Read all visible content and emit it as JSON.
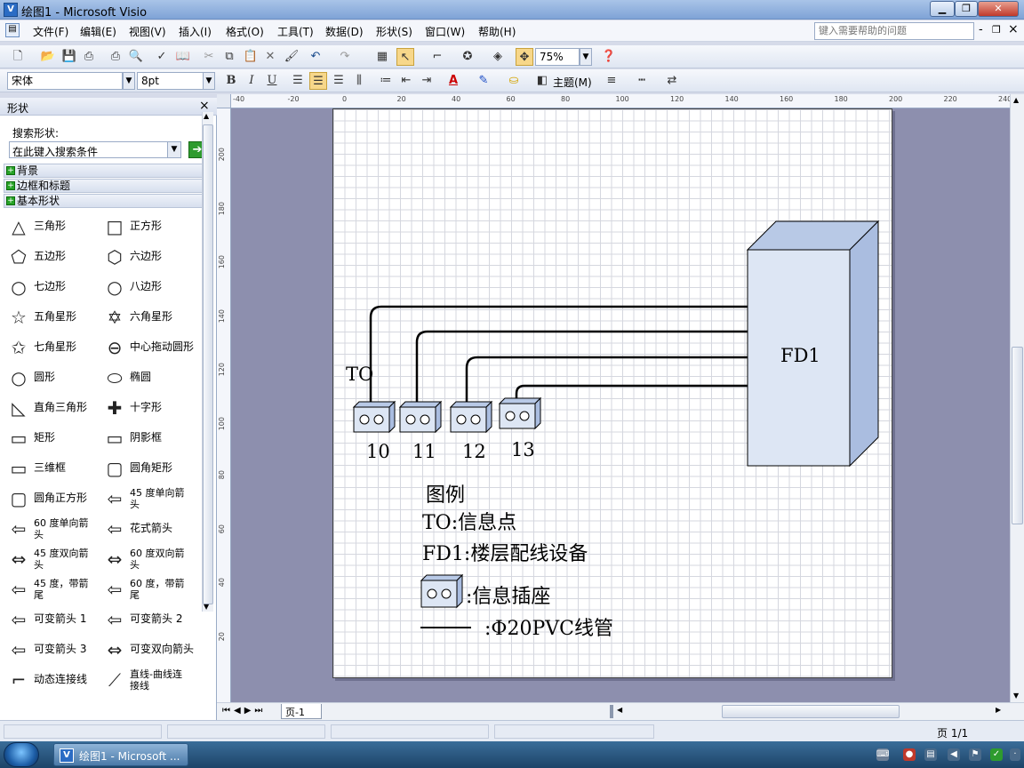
{
  "window": {
    "title": "绘图1 - Microsoft Visio",
    "app_icon": "visio-icon",
    "minimize": "▁",
    "restore": "❐",
    "close": "✕"
  },
  "menu": [
    "文件(F)",
    "编辑(E)",
    "视图(V)",
    "插入(I)",
    "格式(O)",
    "工具(T)",
    "数据(D)",
    "形状(S)",
    "窗口(W)",
    "帮助(H)"
  ],
  "help_search": {
    "placeholder": "键入需要帮助的问题"
  },
  "mdi": {
    "min": "-",
    "restore": "❐",
    "close": "×"
  },
  "toolbar": {
    "zoom": "75%"
  },
  "format": {
    "font": "宋体",
    "size": "8pt",
    "bold": "B",
    "italic": "I",
    "underline": "U",
    "theme": "主题(M)"
  },
  "shapes_panel": {
    "title": "形状",
    "close": "×",
    "search_label": "搜索形状:",
    "search_placeholder": "在此键入搜索条件",
    "stencils": [
      "背景",
      "边框和标题",
      "基本形状"
    ],
    "items": [
      {
        "label": "三角形",
        "icon": "triangle-icon",
        "glyph": "△"
      },
      {
        "label": "正方形",
        "icon": "square-icon",
        "glyph": "□"
      },
      {
        "label": "五边形",
        "icon": "pentagon-icon",
        "glyph": "⬠"
      },
      {
        "label": "六边形",
        "icon": "hexagon-icon",
        "glyph": "⬡"
      },
      {
        "label": "七边形",
        "icon": "heptagon-icon",
        "glyph": "○"
      },
      {
        "label": "八边形",
        "icon": "octagon-icon",
        "glyph": "○"
      },
      {
        "label": "五角星形",
        "icon": "star5-icon",
        "glyph": "☆"
      },
      {
        "label": "六角星形",
        "icon": "star6-icon",
        "glyph": "✡"
      },
      {
        "label": "七角星形",
        "icon": "star7-icon",
        "glyph": "✩"
      },
      {
        "label": "中心拖动圆形",
        "icon": "center-circle-icon",
        "glyph": "⊖"
      },
      {
        "label": "圆形",
        "icon": "circle-icon",
        "glyph": "○"
      },
      {
        "label": "椭圆",
        "icon": "ellipse-icon",
        "glyph": "⬭"
      },
      {
        "label": "直角三角形",
        "icon": "right-triangle-icon",
        "glyph": "◺"
      },
      {
        "label": "十字形",
        "icon": "cross-icon",
        "glyph": "✚"
      },
      {
        "label": "矩形",
        "icon": "rectangle-icon",
        "glyph": "▭"
      },
      {
        "label": "阴影框",
        "icon": "shadow-box-icon",
        "glyph": "▭"
      },
      {
        "label": "三维框",
        "icon": "3d-box-icon",
        "glyph": "▭"
      },
      {
        "label": "圆角矩形",
        "icon": "rounded-rect-icon",
        "glyph": "▢"
      },
      {
        "label": "圆角正方形",
        "icon": "rounded-square-icon",
        "glyph": "▢"
      },
      {
        "label": "45 度单向箭头",
        "icon": "arrow-45-icon",
        "glyph": "⇦",
        "l1": "45  度单向箭",
        "l2": "头"
      },
      {
        "label": "60 度单向箭头",
        "icon": "arrow-60-icon",
        "glyph": "⇦",
        "l1": "60  度单向箭",
        "l2": "头"
      },
      {
        "label": "花式箭头",
        "icon": "fancy-arrow-icon",
        "glyph": "⇦"
      },
      {
        "label": "45 度双向箭头",
        "icon": "double-arrow-45-icon",
        "glyph": "⇔",
        "l1": "45  度双向箭",
        "l2": "头"
      },
      {
        "label": "60 度双向箭头",
        "icon": "double-arrow-60-icon",
        "glyph": "⇔",
        "l1": "60  度双向箭",
        "l2": "头"
      },
      {
        "label": "45 度，带箭尾",
        "icon": "tail-arrow-45-icon",
        "glyph": "⇦",
        "l1": "45  度，带箭",
        "l2": "尾"
      },
      {
        "label": "60 度，带箭尾",
        "icon": "tail-arrow-60-icon",
        "glyph": "⇦",
        "l1": "60  度，带箭",
        "l2": "尾"
      },
      {
        "label": "可变箭头 1",
        "icon": "var-arrow-1-icon",
        "glyph": "⇦"
      },
      {
        "label": "可变箭头 2",
        "icon": "var-arrow-2-icon",
        "glyph": "⇦"
      },
      {
        "label": "可变箭头 3",
        "icon": "var-arrow-3-icon",
        "glyph": "⇦"
      },
      {
        "label": "可变双向箭头",
        "icon": "var-double-arrow-icon",
        "glyph": "⇔"
      },
      {
        "label": "动态连接线",
        "icon": "dynamic-connector-icon",
        "glyph": "⌐"
      },
      {
        "label": "直线-曲线连接线",
        "icon": "line-curve-connector-icon",
        "glyph": "⟋",
        "l1": "直线-曲线连",
        "l2": "接线"
      }
    ]
  },
  "ruler": {
    "top": [
      "-40",
      "-20",
      "0",
      "20",
      "40",
      "60",
      "80",
      "100",
      "120",
      "140",
      "160",
      "180",
      "200",
      "220",
      "240"
    ],
    "left": [
      "200",
      "180",
      "160",
      "140",
      "120",
      "100",
      "80",
      "60",
      "40",
      "20"
    ]
  },
  "drawing": {
    "to_label": "TO",
    "outlets": [
      "10",
      "11",
      "12",
      "13"
    ],
    "fd_label": "FD1",
    "legend": {
      "title": "图例",
      "line1": "TO:信息点",
      "line2": "FD1:楼层配线设备",
      "outlet": ":信息插座",
      "pipe": ":Φ20PVC线管"
    },
    "colors": {
      "box_front": "#dde6f4",
      "box_top": "#b8c9e6",
      "box_side": "#aabde0"
    }
  },
  "page_tab": "页-1",
  "status": {
    "page": "页 1/1"
  },
  "taskbar": {
    "task": "绘图1 - Microsoft ..."
  }
}
